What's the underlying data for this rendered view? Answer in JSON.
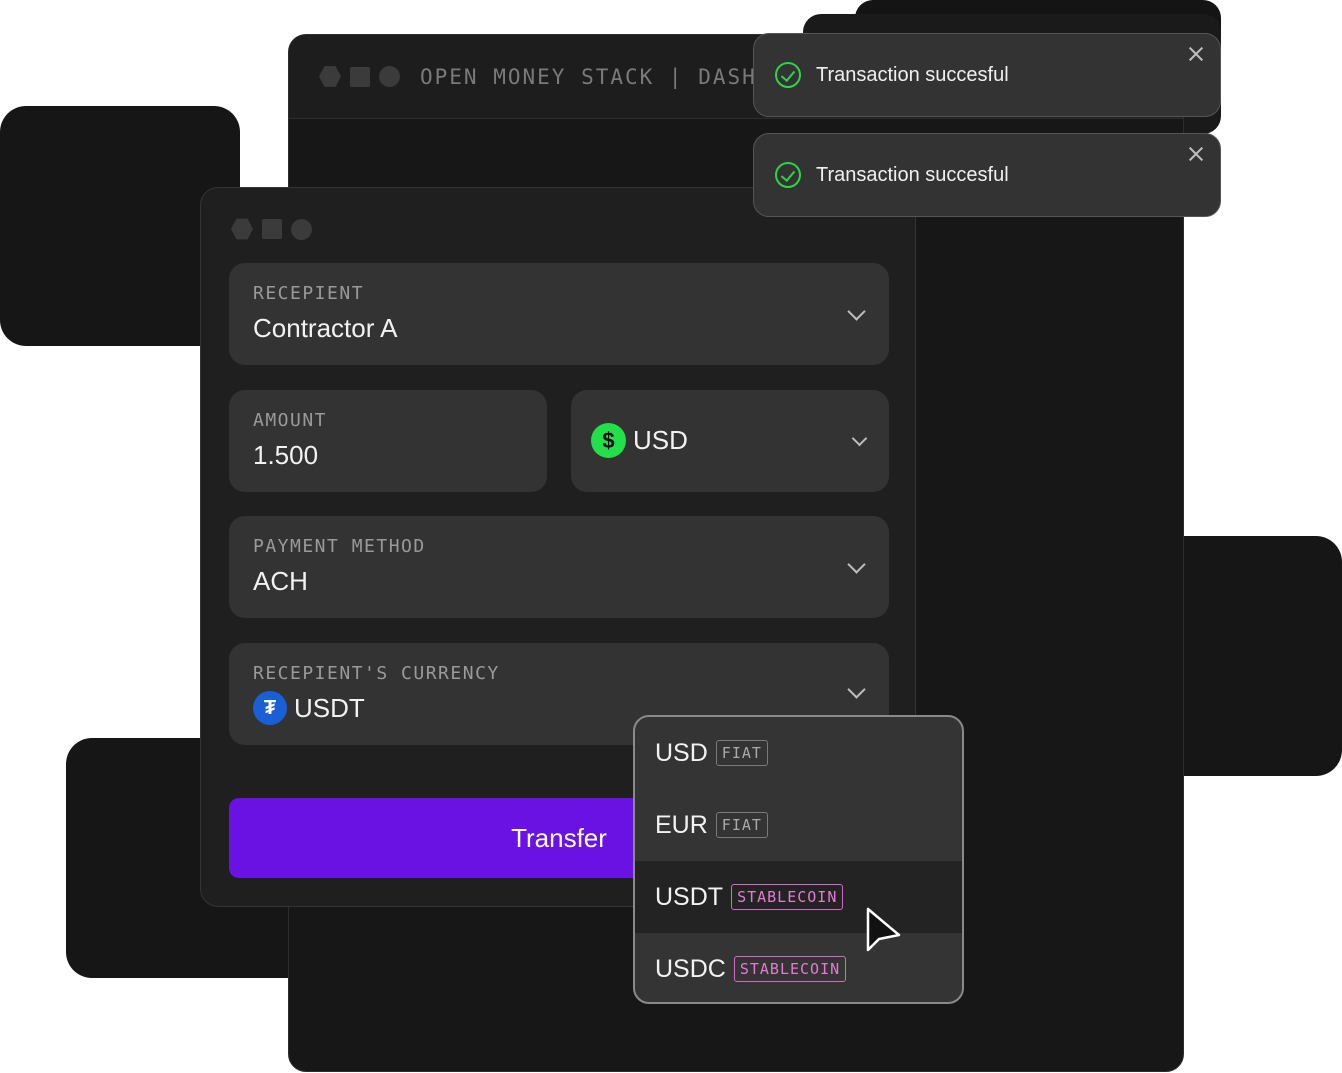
{
  "background_window": {
    "title": "OPEN MONEY STACK | DASHB"
  },
  "form": {
    "recipient": {
      "label": "RECEPIENT",
      "value": "Contractor A"
    },
    "amount": {
      "label": "AMOUNT",
      "value": "1.500"
    },
    "currency": {
      "value": "USD",
      "icon": "dollar-coin-icon",
      "icon_glyph": "$"
    },
    "payment_method": {
      "label": "PAYMENT METHOD",
      "value": "ACH"
    },
    "recipient_currency": {
      "label": "RECEPIENT'S CURRENCY",
      "value": "USDT",
      "icon": "tether-coin-icon",
      "icon_glyph": "₮"
    },
    "transfer_label": "Transfer"
  },
  "dropdown": {
    "options": [
      {
        "name": "USD",
        "tag": "FIAT"
      },
      {
        "name": "EUR",
        "tag": "FIAT"
      },
      {
        "name": "USDT",
        "tag": "STABLECOIN"
      },
      {
        "name": "USDC",
        "tag": "STABLECOIN"
      }
    ],
    "highlighted": "USDT"
  },
  "toasts": [
    {
      "message": "Transaction succesful"
    },
    {
      "message": "Transaction succesful"
    }
  ],
  "colors": {
    "accent": "#6a12e4",
    "success": "#2fd34a",
    "stablecoin_tag": "#e57ad6",
    "usd_coin": "#22e04a",
    "tether_coin": "#1a5fd6"
  }
}
